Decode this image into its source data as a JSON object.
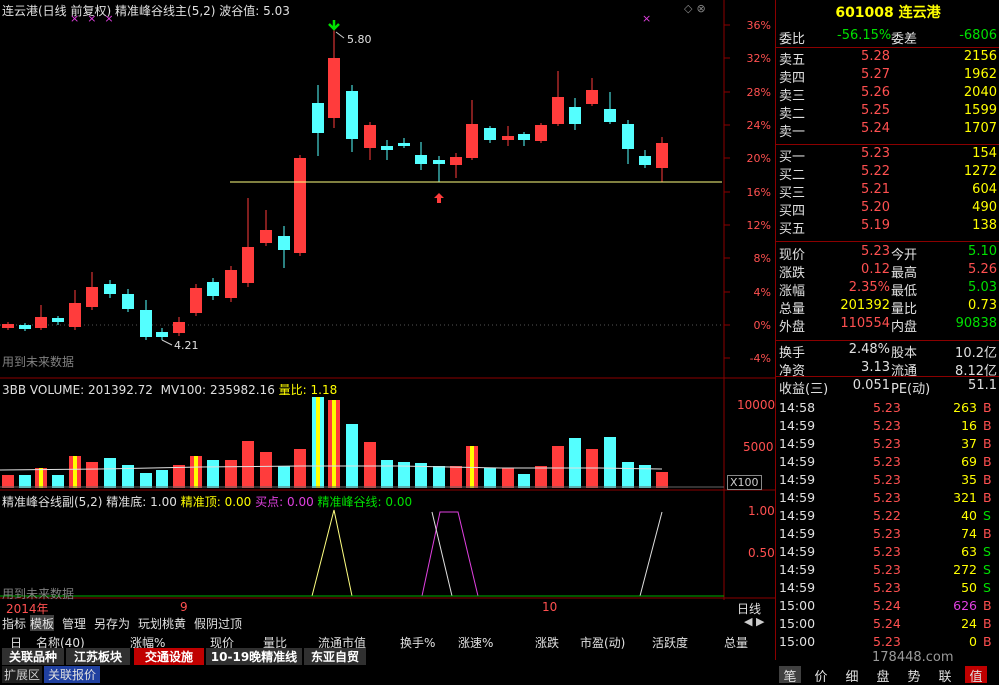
{
  "header": {
    "title": "连云港(日线 前复权)",
    "indicator_main": "精准峰谷线主(5,2)",
    "wave_label": "波谷值:",
    "wave_value": "5.03",
    "note_future": "用到未来数据",
    "note_future2": "用到未来数据",
    "max_label": "5.80",
    "min_label": "4.21"
  },
  "price_axis": [
    "36%",
    "32%",
    "28%",
    "24%",
    "20%",
    "16%",
    "12%",
    "8%",
    "4%",
    "0%",
    "-4%"
  ],
  "volume_header": {
    "title": "3BB VOLUME:",
    "value": "201392.72",
    "mv_label": "MV100:",
    "mv_value": "235982.16",
    "ratio_label": "量比:",
    "ratio_value": "1.18"
  },
  "volume_axis": [
    "10000",
    "5000"
  ],
  "volume_unit": "X100",
  "sub_header": {
    "title": "精准峰谷线副(5,2)",
    "bottom_label": "精准底:",
    "bottom_value": "1.00",
    "top_label": "精准顶:",
    "top_value": "0.00",
    "buy_label": "买点:",
    "buy_value": "0.00",
    "line_label": "精准峰谷线:",
    "line_value": "0.00"
  },
  "sub_axis": [
    "1.00",
    "0.50"
  ],
  "time_axis": {
    "year": "2014年",
    "m9": "9",
    "m10": "10",
    "period": "日线"
  },
  "stock": {
    "code": "601008",
    "name": "连云港"
  },
  "ratio_row": {
    "label1": "委比",
    "value1": "-56.15%",
    "label2": "委差",
    "value2": "-6806"
  },
  "sells": [
    {
      "label": "卖五",
      "price": "5.28",
      "vol": "2156"
    },
    {
      "label": "卖四",
      "price": "5.27",
      "vol": "1962"
    },
    {
      "label": "卖三",
      "price": "5.26",
      "vol": "2040"
    },
    {
      "label": "卖二",
      "price": "5.25",
      "vol": "1599"
    },
    {
      "label": "卖一",
      "price": "5.24",
      "vol": "1707"
    }
  ],
  "buys": [
    {
      "label": "买一",
      "price": "5.23",
      "vol": "154"
    },
    {
      "label": "买二",
      "price": "5.22",
      "vol": "1272"
    },
    {
      "label": "买三",
      "price": "5.21",
      "vol": "604"
    },
    {
      "label": "买四",
      "price": "5.20",
      "vol": "490"
    },
    {
      "label": "买五",
      "price": "5.19",
      "vol": "138"
    }
  ],
  "stats1": [
    {
      "l1": "现价",
      "v1": "5.23",
      "l2": "今开",
      "v2": "5.10"
    },
    {
      "l1": "涨跌",
      "v1": "0.12",
      "l2": "最高",
      "v2": "5.26"
    },
    {
      "l1": "涨幅",
      "v1": "2.35%",
      "l2": "最低",
      "v2": "5.03"
    },
    {
      "l1": "总量",
      "v1": "201392",
      "l2": "量比",
      "v2": "0.73"
    },
    {
      "l1": "外盘",
      "v1": "110554",
      "l2": "内盘",
      "v2": "90838"
    }
  ],
  "stats2": [
    {
      "l1": "换手",
      "v1": "2.48%",
      "l2": "股本",
      "v2": "10.2亿"
    },
    {
      "l1": "净资",
      "v1": "3.13",
      "l2": "流通",
      "v2": "8.12亿"
    },
    {
      "l1": "收益(三)",
      "v1": "0.051",
      "l2": "PE(动)",
      "v2": "51.1"
    }
  ],
  "ticks": [
    {
      "t": "14:58",
      "p": "5.23",
      "v": "263",
      "s": "B"
    },
    {
      "t": "14:59",
      "p": "5.23",
      "v": "16",
      "s": "B"
    },
    {
      "t": "14:59",
      "p": "5.23",
      "v": "37",
      "s": "B"
    },
    {
      "t": "14:59",
      "p": "5.23",
      "v": "69",
      "s": "B"
    },
    {
      "t": "14:59",
      "p": "5.23",
      "v": "35",
      "s": "B"
    },
    {
      "t": "14:59",
      "p": "5.23",
      "v": "321",
      "s": "B"
    },
    {
      "t": "14:59",
      "p": "5.22",
      "v": "40",
      "s": "S"
    },
    {
      "t": "14:59",
      "p": "5.23",
      "v": "74",
      "s": "B"
    },
    {
      "t": "14:59",
      "p": "5.23",
      "v": "63",
      "s": "S"
    },
    {
      "t": "14:59",
      "p": "5.23",
      "v": "272",
      "s": "S"
    },
    {
      "t": "14:59",
      "p": "5.23",
      "v": "50",
      "s": "S"
    },
    {
      "t": "15:00",
      "p": "5.24",
      "v": "626",
      "s": "B"
    },
    {
      "t": "15:00",
      "p": "5.24",
      "v": "24",
      "s": "B"
    },
    {
      "t": "15:00",
      "p": "5.23",
      "v": "0",
      "s": "B"
    }
  ],
  "toolbar": [
    "指标",
    "模板",
    "管理",
    "另存为",
    "玩划桃黄",
    "假阴过顶"
  ],
  "columns": [
    "日",
    "名称(40)",
    "涨幅%",
    "现价",
    "量比",
    "流通市值",
    "换手%",
    "涨速%",
    "涨跌",
    "市盈(动)",
    "活跃度",
    "总量"
  ],
  "sector_tabs": [
    "关联品种",
    "江苏板块",
    "交通设施",
    "10-19晚精准线",
    "东亚自贸"
  ],
  "bottom_tabs": [
    "扩展区",
    "关联报价"
  ],
  "right_tabs": [
    "笔",
    "价",
    "细",
    "盘",
    "势",
    "联",
    "值"
  ],
  "watermark": "178448.com",
  "colors": {
    "up": "#ff3c3c",
    "down": "#54ffff",
    "grid": "#8b0000"
  }
}
